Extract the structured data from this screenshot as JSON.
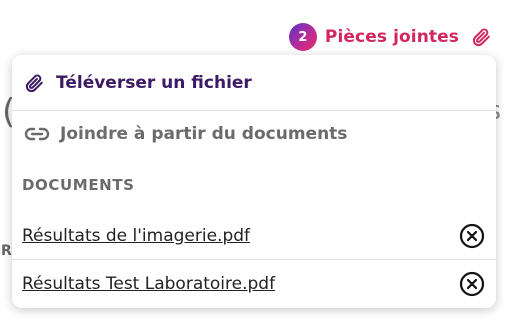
{
  "attachments": {
    "count": "2",
    "label": "Pièces jointes",
    "icon": "paperclip-icon",
    "accent_color": "#d32660"
  },
  "menu": {
    "upload_label": "Téléverser un fichier",
    "upload_icon": "paperclip-icon",
    "link_label": "Joindre à partir du documents",
    "link_icon": "link-icon"
  },
  "documents": {
    "header": "DOCUMENTS",
    "items": [
      {
        "name": "Résultats de l'imagerie.pdf",
        "remove_icon": "close-circle-icon"
      },
      {
        "name": "Résultats Test Laboratoire.pdf",
        "remove_icon": "close-circle-icon"
      }
    ]
  }
}
